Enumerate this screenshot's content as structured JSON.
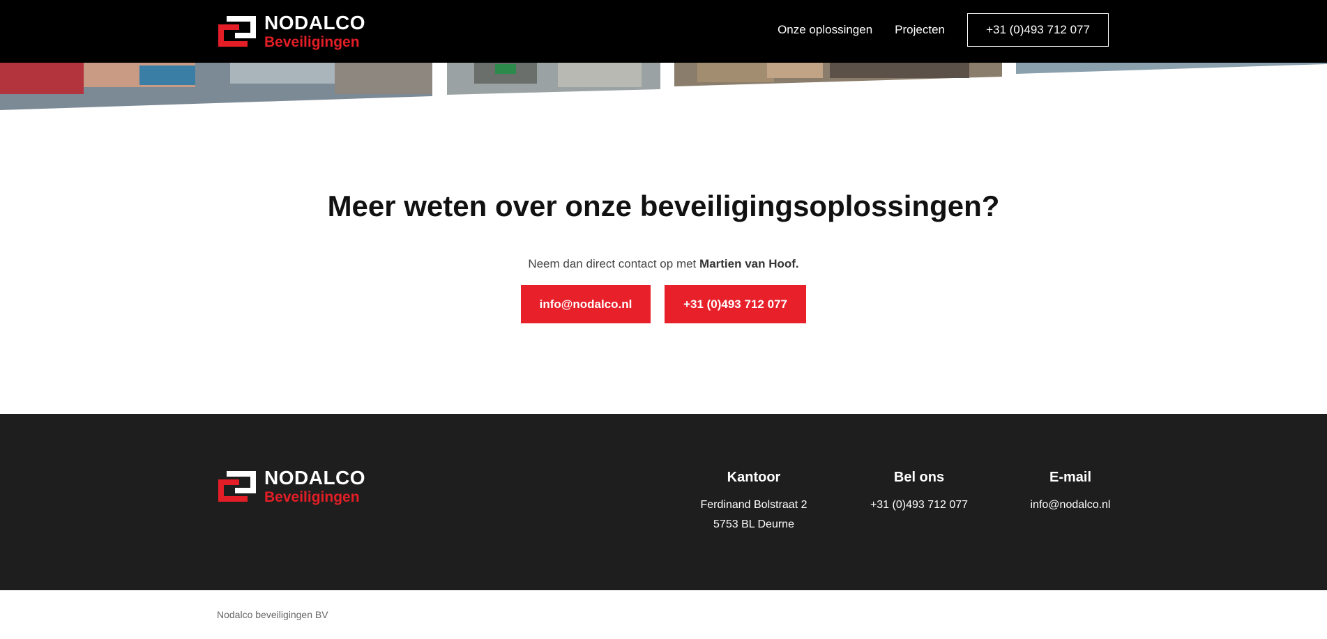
{
  "brand": {
    "name": "NODALCO",
    "tagline": "Beveiligingen",
    "red": "#e41e26"
  },
  "nav": {
    "items": [
      {
        "label": "Onze oplossingen"
      },
      {
        "label": "Projecten"
      }
    ],
    "phone": "+31 (0)493 712 077"
  },
  "cta": {
    "title": "Meer weten over onze beveiligingsoplossingen?",
    "text_prefix": "Neem dan direct contact op met",
    "contact_name": "Martien van Hoof.",
    "email_button": "info@nodalco.nl",
    "phone_button": "+31 (0)493 712 077"
  },
  "footer": {
    "kantoor": {
      "heading": "Kantoor",
      "line1": "Ferdinand Bolstraat 2",
      "line2": "5753 BL Deurne"
    },
    "bel_ons": {
      "heading": "Bel ons",
      "value": "+31 (0)493 712 077"
    },
    "email": {
      "heading": "E-mail",
      "value": "info@nodalco.nl"
    }
  },
  "copyright": "Nodalco beveiligingen BV",
  "colors": {
    "header_bg": "#000000",
    "footer_bg": "#1e1e1e",
    "button_red": "#e8202a"
  }
}
